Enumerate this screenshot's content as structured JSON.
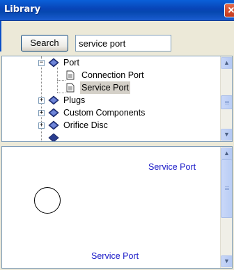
{
  "window": {
    "title": "Library",
    "close_glyph": "✕"
  },
  "search": {
    "button_label": "Search",
    "query": "service port"
  },
  "tree": {
    "items": [
      {
        "label": "Port",
        "icon": "book-icon",
        "expander": "−",
        "depth": 0
      },
      {
        "label": "Connection Port",
        "icon": "document-icon",
        "depth": 1
      },
      {
        "label": "Service Port",
        "icon": "document-icon",
        "depth": 1,
        "selected": true
      },
      {
        "label": "Plugs",
        "icon": "book-icon",
        "expander": "+",
        "depth": 0
      },
      {
        "label": "Custom Components",
        "icon": "book-icon",
        "expander": "+",
        "depth": 0
      },
      {
        "label": "Orifice Disc",
        "icon": "book-icon",
        "expander": "+",
        "depth": 0
      }
    ],
    "scroll": {
      "up_glyph": "▲",
      "down_glyph": "▼"
    }
  },
  "preview": {
    "top_label": "Service Port",
    "bottom_label": "Service Port",
    "shape": "circle",
    "text_color": "#1b1bc8",
    "scroll": {
      "up_glyph": "▲",
      "down_glyph": "▼"
    }
  },
  "colors": {
    "titlebar": "#0844b6",
    "selection": "#d4d0c8",
    "panel_border": "#7f9db9"
  }
}
